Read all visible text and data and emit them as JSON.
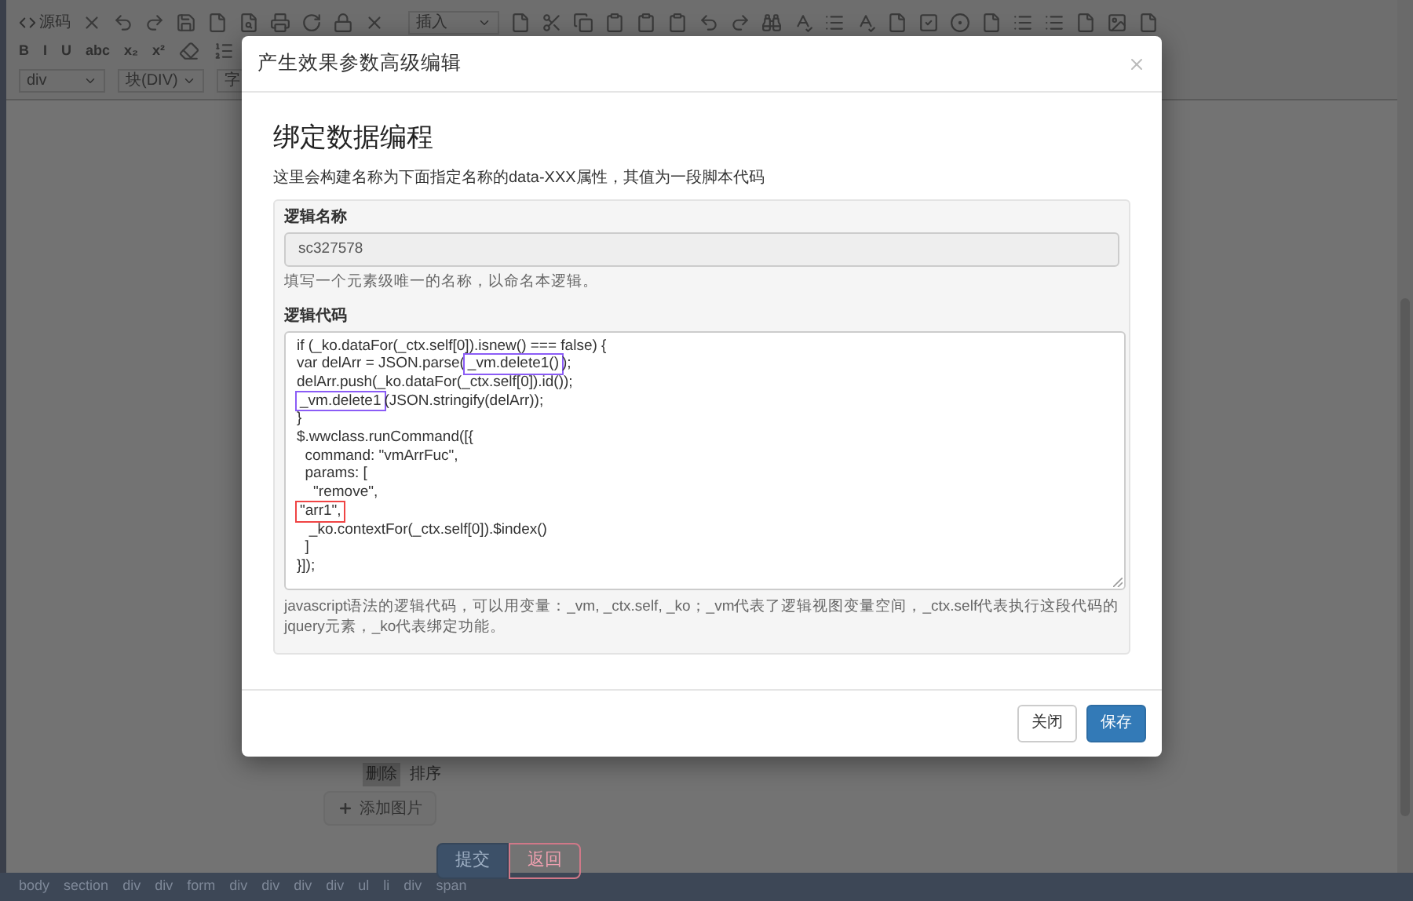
{
  "editor": {
    "source_label": "源码",
    "insert_dropdown": "插入",
    "format_buttons": [
      "B",
      "I",
      "U",
      "abc",
      "x₂",
      "x²"
    ],
    "style_dropdowns": [
      "div",
      "块(DIV)",
      "字"
    ]
  },
  "background_page": {
    "image_actions": [
      "删除",
      "排序"
    ],
    "add_image_button": "添加图片",
    "submit_button": "提交",
    "back_button": "返回"
  },
  "breadcrumb": [
    "body",
    "section",
    "div",
    "div",
    "form",
    "div",
    "div",
    "div",
    "div",
    "ul",
    "li",
    "div",
    "span"
  ],
  "dialog": {
    "title": "产生效果参数高级编辑",
    "heading": "绑定数据编程",
    "description": "这里会构建名称为下面指定名称的data-XXX属性，其值为一段脚本代码",
    "logic_name": {
      "label": "逻辑名称",
      "value": "sc327578",
      "help": "填写一个元素级唯一的名称，以命名本逻辑。"
    },
    "logic_code": {
      "label": "逻辑代码",
      "lines": [
        [
          {
            "text": "if (_ko.dataFor(_ctx.self[0]).isnew() === false) {"
          }
        ],
        [
          {
            "text": "var delArr = JSON.parse("
          },
          {
            "text": "_vm.delete1()",
            "color": "#8b5cf6"
          },
          {
            "text": ");"
          }
        ],
        [
          {
            "text": "delArr.push(_ko.dataFor(_ctx.self[0]).id());"
          }
        ],
        [
          {
            "text": "_vm.delete1",
            "color": "#8b5cf6"
          },
          {
            "text": "(JSON.stringify(delArr));"
          }
        ],
        [
          {
            "text": "}"
          }
        ],
        [
          {
            "text": "$.wwclass.runCommand([{"
          }
        ],
        [
          {
            "text": "  command: \"vmArrFuc\","
          }
        ],
        [
          {
            "text": "  params: ["
          }
        ],
        [
          {
            "text": "    \"remove\","
          }
        ],
        [
          {
            "text": "\"arr1\",",
            "color": "#ef4444"
          }
        ],
        [
          {
            "text": "   _ko.contextFor(_ctx.self[0]).$index()"
          }
        ],
        [
          {
            "text": "  ]"
          }
        ],
        [
          {
            "text": "}]);"
          }
        ]
      ],
      "help": "javascript语法的逻辑代码，可以用变量：_vm, _ctx.self, _ko；_vm代表了逻辑视图变量空间，_ctx.self代表执行这段代码的jquery元素，_ko代表绑定功能。"
    },
    "buttons": [
      {
        "label": "关闭",
        "kind": "default"
      },
      {
        "label": "保存",
        "kind": "primary"
      }
    ]
  }
}
